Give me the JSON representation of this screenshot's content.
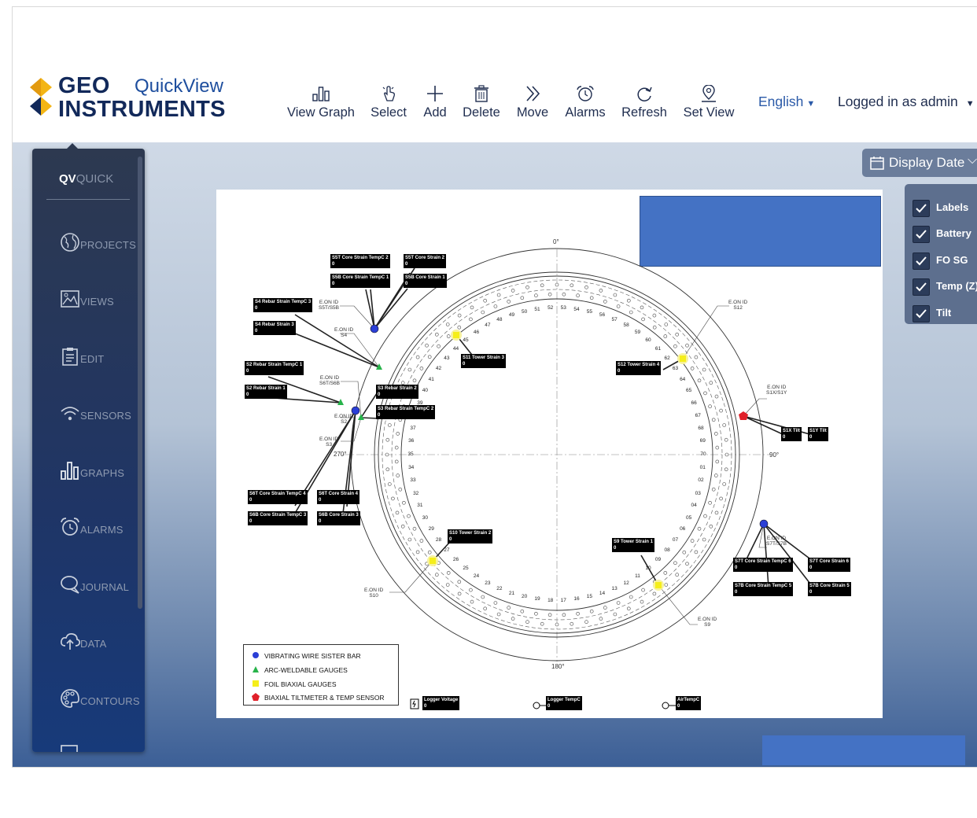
{
  "header": {
    "logo_line1": "GEO",
    "logo_product": "QuickView",
    "logo_line2": "INSTRUMENTS",
    "toolbar": [
      {
        "label": "View Graph",
        "icon": "bar-chart-icon"
      },
      {
        "label": "Select",
        "icon": "pointer-hand-icon"
      },
      {
        "label": "Add",
        "icon": "plus-icon"
      },
      {
        "label": "Delete",
        "icon": "trash-icon"
      },
      {
        "label": "Move",
        "icon": "double-chevron-right-icon"
      },
      {
        "label": "Alarms",
        "icon": "alarm-clock-icon"
      },
      {
        "label": "Refresh",
        "icon": "refresh-icon"
      },
      {
        "label": "Set View",
        "icon": "location-pin-icon"
      }
    ],
    "language": "English",
    "user": "Logged in as admin"
  },
  "sidebar": {
    "title_bold": "QV",
    "title_rest": "QUICK",
    "items": [
      {
        "label": "PROJECTS",
        "icon": "globe-icon"
      },
      {
        "label": "VIEWS",
        "icon": "image-icon"
      },
      {
        "label": "EDIT",
        "icon": "clipboard-icon"
      },
      {
        "label": "SENSORS",
        "icon": "wifi-icon"
      },
      {
        "label": "GRAPHS",
        "icon": "bar-chart-icon"
      },
      {
        "label": "ALARMS",
        "icon": "alarm-clock-icon"
      },
      {
        "label": "JOURNAL",
        "icon": "chat-icon"
      },
      {
        "label": "DATA",
        "icon": "cloud-upload-icon"
      },
      {
        "label": "CONTOURS",
        "icon": "palette-icon"
      }
    ]
  },
  "display_date": {
    "label": "Display Date",
    "icon": "calendar-icon"
  },
  "layers": [
    {
      "label": "Labels",
      "checked": true
    },
    {
      "label": "Battery",
      "checked": true
    },
    {
      "label": "FO SG",
      "checked": true
    },
    {
      "label": "Temp (Z)",
      "checked": true
    },
    {
      "label": "Tilt",
      "checked": true
    }
  ],
  "drawing": {
    "angles": {
      "top": "0°",
      "right": "90°",
      "bottom": "180°",
      "left": "270°"
    },
    "sensor_labels": [
      {
        "name": "S5T Core Strain TempC 2",
        "value": "0"
      },
      {
        "name": "S5T Core Strain 2",
        "value": "0"
      },
      {
        "name": "S5B Core Strain TempC 1",
        "value": "0"
      },
      {
        "name": "S5B Core Strain 1",
        "value": "0"
      },
      {
        "name": "S4 Rebar Strain TempC 3",
        "value": "0"
      },
      {
        "name": "S4 Rebar Strain 3",
        "value": "0"
      },
      {
        "name": "S11 Tower Strain 3",
        "value": "0"
      },
      {
        "name": "S12 Tower Strain 4",
        "value": "0"
      },
      {
        "name": "S2 Rebar Strain TempC 1",
        "value": "0"
      },
      {
        "name": "S2 Rebar Strain 1",
        "value": "0"
      },
      {
        "name": "S3 Rebar Strain 2",
        "value": "0"
      },
      {
        "name": "S3 Rebar Strain TempC 2",
        "value": "0"
      },
      {
        "name": "S1X Tilt",
        "value": "0"
      },
      {
        "name": "S1Y Tilt",
        "value": "0"
      },
      {
        "name": "S6T Core Strain TempC 4",
        "value": "0"
      },
      {
        "name": "S6T Core Strain 4",
        "value": "0"
      },
      {
        "name": "S6B Core Strain TempC 3",
        "value": "0"
      },
      {
        "name": "S6B Core Strain 3",
        "value": "0"
      },
      {
        "name": "S10 Tower Strain 2",
        "value": "0"
      },
      {
        "name": "S9 Tower Strain 1",
        "value": "0"
      },
      {
        "name": "S7T Core Strain TempC 6",
        "value": "0"
      },
      {
        "name": "S7T Core Strain 6",
        "value": "0"
      },
      {
        "name": "S7B Core Strain TempC 5",
        "value": "0"
      },
      {
        "name": "S7B Core Strain 5",
        "value": "0"
      },
      {
        "name": "Logger Voltage",
        "value": "0"
      },
      {
        "name": "Logger TempC",
        "value": "0"
      },
      {
        "name": "AirTempC",
        "value": "0"
      }
    ],
    "eon_ids": [
      {
        "line1": "E.ON ID",
        "line2": "S5T/S5B"
      },
      {
        "line1": "E.ON ID",
        "line2": "S4"
      },
      {
        "line1": "E.ON ID",
        "line2": "S6T/S6B"
      },
      {
        "line1": "E.ON ID",
        "line2": "S2"
      },
      {
        "line1": "E.ON ID",
        "line2": "S3"
      },
      {
        "line1": "E.ON ID",
        "line2": "S12"
      },
      {
        "line1": "E.ON ID",
        "line2": "S1X/S1Y"
      },
      {
        "line1": "E.ON ID",
        "line2": "S7T/S7B"
      },
      {
        "line1": "E.ON ID",
        "line2": "S10"
      },
      {
        "line1": "E.ON ID",
        "line2": "S9"
      }
    ],
    "legend": [
      {
        "label": "VIBRATING WIRE SISTER BAR",
        "color": "#2b3fd6",
        "shape": "circle"
      },
      {
        "label": "ARC-WELDABLE GAUGES",
        "color": "#27b34a",
        "shape": "triangle"
      },
      {
        "label": "FOIL BIAXIAL GAUGES",
        "color": "#f5ee1a",
        "shape": "square"
      },
      {
        "label": "BIAXIAL TILTMETER & TEMP SENSOR",
        "color": "#e0202a",
        "shape": "pentagon"
      }
    ]
  }
}
